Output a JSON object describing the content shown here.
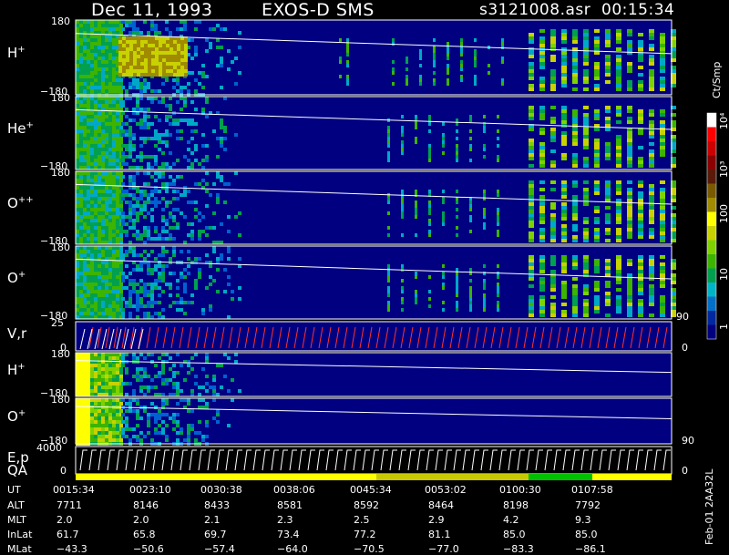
{
  "header": {
    "date": "Dec 11, 1993",
    "instrument": "EXOS-D SMS",
    "file": "s3121008.asr",
    "time": "00:15:34"
  },
  "panels": [
    {
      "label": "H",
      "sup": "+",
      "ytop": "180",
      "ybot": "−180"
    },
    {
      "label": "He",
      "sup": "+",
      "ytop": "180",
      "ybot": "−180"
    },
    {
      "label": "O",
      "sup": "++",
      "ytop": "180",
      "ybot": "−180"
    },
    {
      "label": "O",
      "sup": "+",
      "ytop": "180",
      "ybot": "−180"
    },
    {
      "label": "V,r",
      "sup": "",
      "ytop": "25",
      "ybot": "0",
      "rtop": "90",
      "rbot": "0"
    },
    {
      "label": "H",
      "sup": "+",
      "ytop": "180",
      "ybot": "−180"
    },
    {
      "label": "O",
      "sup": "+",
      "ytop": "180",
      "ybot": "−180",
      "rbot": "90"
    },
    {
      "label": "E,p",
      "sup": "",
      "ytop": "4000",
      "ybot": "0",
      "rbot": "0"
    }
  ],
  "qa_label": "QA",
  "colorbar": {
    "unit": "Ct/Smp",
    "ticks": [
      "10⁴",
      "10³",
      "100",
      "10",
      "1"
    ],
    "colors": [
      "#ffffff",
      "#ff0000",
      "#cc0000",
      "#8b0000",
      "#5a1a0a",
      "#7a5a00",
      "#a08a00",
      "#ffff00",
      "#c8d200",
      "#7fd200",
      "#3cb400",
      "#00a050",
      "#00b4c8",
      "#0070c8",
      "#0028a0",
      "#000080"
    ]
  },
  "side_note": "Feb-01 2AA32L",
  "ephemeris": {
    "labels": [
      "UT",
      "ALT",
      "MLT",
      "InLat",
      "MLat"
    ],
    "columns": [
      {
        "UT": "0015:34",
        "ALT": "7711",
        "MLT": "2.0",
        "InLat": "61.7",
        "MLat": "−43.3"
      },
      {
        "UT": "0023:10",
        "ALT": "8146",
        "MLT": "2.0",
        "InLat": "65.8",
        "MLat": "−50.6"
      },
      {
        "UT": "0030:38",
        "ALT": "8433",
        "MLT": "2.1",
        "InLat": "69.7",
        "MLat": "−57.4"
      },
      {
        "UT": "0038:06",
        "ALT": "8581",
        "MLT": "2.3",
        "InLat": "73.4",
        "MLat": "−64.0"
      },
      {
        "UT": "0045:34",
        "ALT": "8592",
        "MLT": "2.5",
        "InLat": "77.2",
        "MLat": "−70.5"
      },
      {
        "UT": "0053:02",
        "ALT": "8464",
        "MLT": "2.9",
        "InLat": "81.1",
        "MLat": "−77.0"
      },
      {
        "UT": "0100:30",
        "ALT": "8198",
        "MLT": "4.2",
        "InLat": "85.0",
        "MLat": "−83.3"
      },
      {
        "UT": "0107:58",
        "ALT": "7792",
        "MLT": "9.3",
        "InLat": "85.0",
        "MLat": "−86.1"
      }
    ]
  },
  "chart_data": {
    "type": "heatmap",
    "title": "Dec 11, 1993   EXOS-D SMS",
    "x_tick_labels": [
      "0015:34",
      "0023:10",
      "0030:38",
      "0038:06",
      "0045:34",
      "0053:02",
      "0100:30",
      "0107:58"
    ],
    "color_scale": "log",
    "color_range": [
      1,
      10000
    ],
    "series": [
      {
        "name": "H+",
        "y_range": [
          -180,
          180
        ]
      },
      {
        "name": "He+",
        "y_range": [
          -180,
          180
        ]
      },
      {
        "name": "O++",
        "y_range": [
          -180,
          180
        ]
      },
      {
        "name": "O+",
        "y_range": [
          -180,
          180
        ]
      },
      {
        "name": "V,r",
        "y_range": [
          0,
          25
        ],
        "y2_range": [
          0,
          90
        ]
      },
      {
        "name": "H+",
        "y_range": [
          -180,
          180
        ]
      },
      {
        "name": "O+",
        "y_range": [
          -180,
          180
        ]
      },
      {
        "name": "E,p",
        "y_range": [
          0,
          4000
        ]
      }
    ]
  }
}
